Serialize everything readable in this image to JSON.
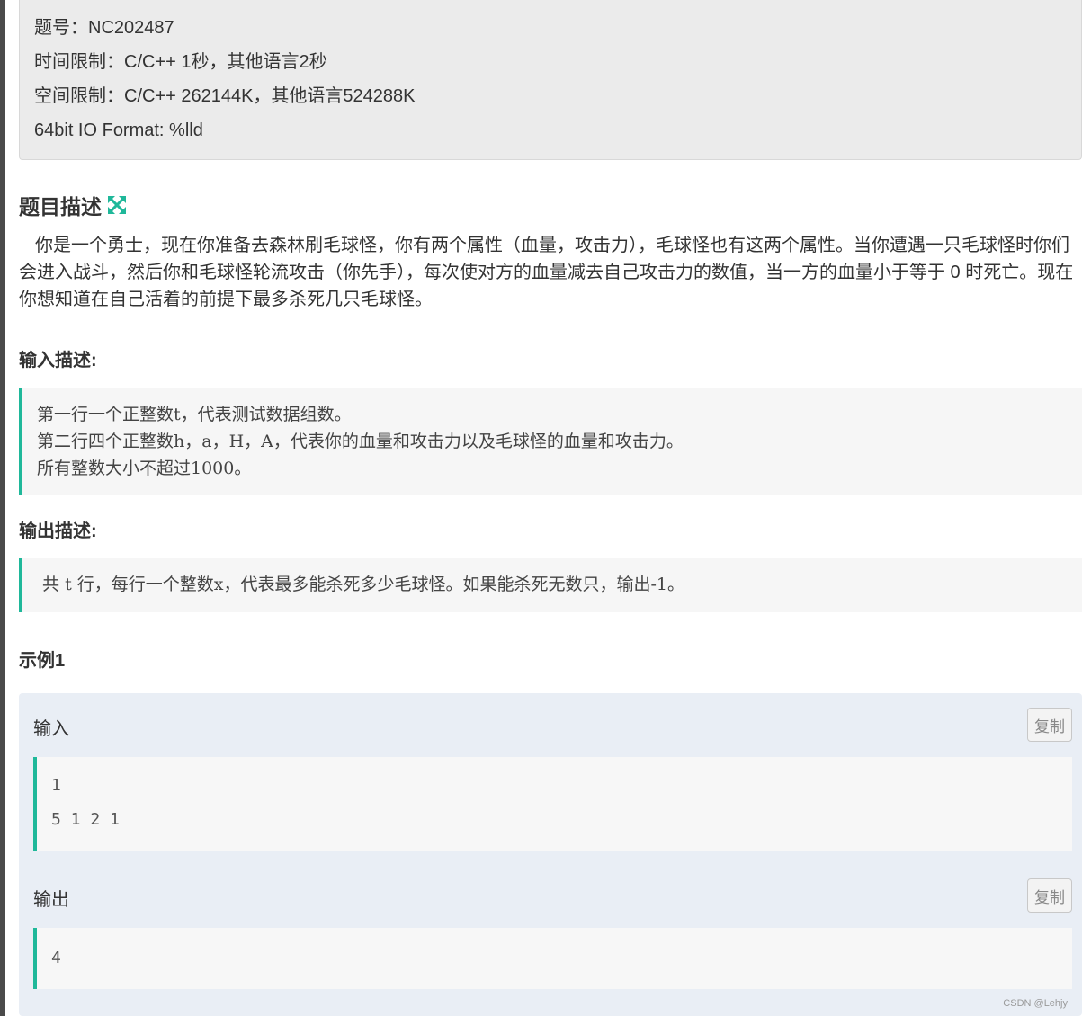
{
  "info": {
    "problem_id": "题号：NC202487",
    "time_limit": "时间限制：C/C++ 1秒，其他语言2秒",
    "memory_limit": "空间限制：C/C++ 262144K，其他语言524288K",
    "io_format": "64bit IO Format: %lld"
  },
  "description": {
    "title": "题目描述",
    "text": "你是一个勇士，现在你准备去森林刷毛球怪，你有两个属性（血量，攻击力），毛球怪也有这两个属性。当你遭遇一只毛球怪时你们会进入战斗，然后你和毛球怪轮流攻击（你先手），每次使对方的血量减去自己攻击力的数值，当一方的血量小于等于 0 时死亡。现在你想知道在自己活着的前提下最多杀死几只毛球怪。"
  },
  "input_desc": {
    "title": "输入描述:",
    "lines": [
      "第一行一个正整数t，代表测试数据组数。",
      "第二行四个正整数h，a，H，A，代表你的血量和攻击力以及毛球怪的血量和攻击力。",
      "所有整数大小不超过1000。"
    ]
  },
  "output_desc": {
    "title": "输出描述:",
    "line": " 共 t 行，每行一个整数x，代表最多能杀死多少毛球怪。如果能杀死无数只，输出-1。"
  },
  "example": {
    "title": "示例1",
    "input_label": "输入",
    "output_label": "输出",
    "copy_label": "复制",
    "input_lines": [
      "1",
      "5 1 2 1"
    ],
    "output_lines": [
      "4"
    ]
  },
  "watermark": "CSDN @Lehjy",
  "colors": {
    "accent": "#1fb89a",
    "info_bg": "#ebebeb",
    "example_bg": "#e9eef5"
  }
}
